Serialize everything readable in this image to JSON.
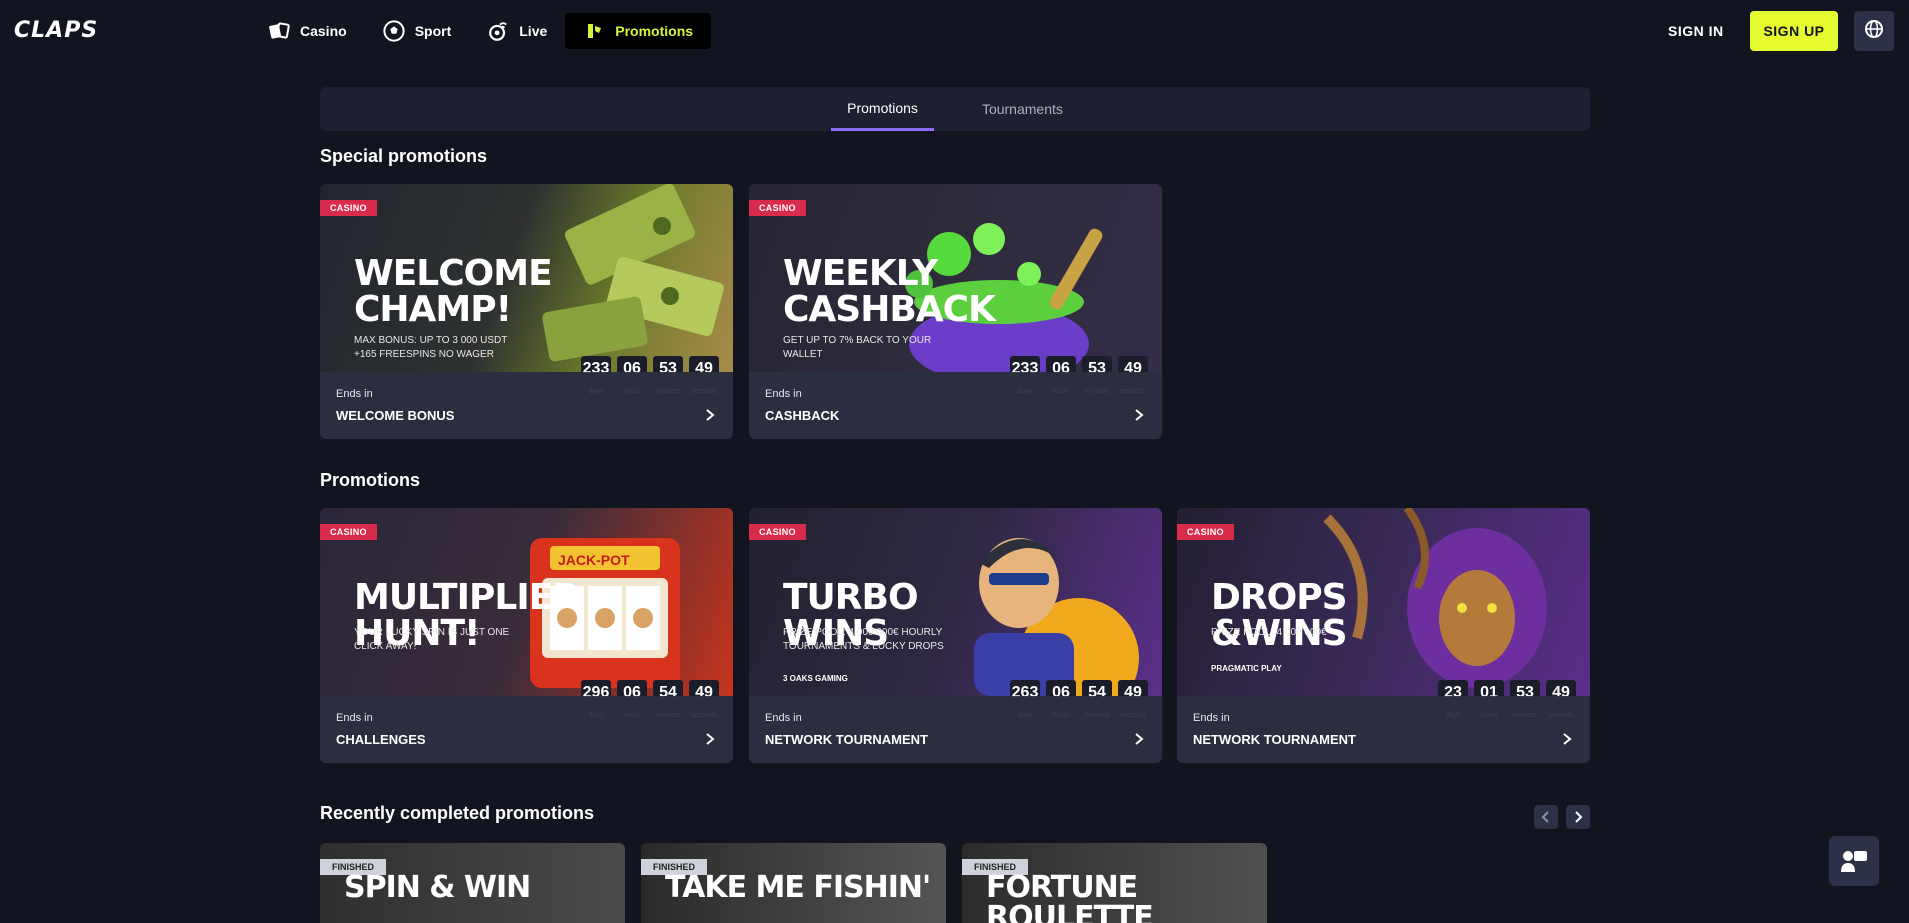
{
  "header": {
    "logo": "CLAPS",
    "nav": [
      {
        "label": "Casino",
        "icon": "cards-icon"
      },
      {
        "label": "Sport",
        "icon": "soccer-ball-icon"
      },
      {
        "label": "Live",
        "icon": "live-icon"
      },
      {
        "label": "Promotions",
        "icon": "promo-icon",
        "active": true
      }
    ],
    "sign_in": "SIGN IN",
    "sign_up": "SIGN UP"
  },
  "tabs": [
    {
      "label": "Promotions",
      "active": true
    },
    {
      "label": "Tournaments"
    }
  ],
  "sections": {
    "special": "Special promotions",
    "promotions": "Promotions",
    "completed": "Recently completed promotions"
  },
  "timer_labels": {
    "days": "days",
    "hours": "hours",
    "minutes": "minutes",
    "seconds": "seconds"
  },
  "ends_in": "Ends in",
  "special_cards": [
    {
      "badge": "CASINO",
      "headline": "WELCOME CHAMP!",
      "sub": "MAX BONUS: UP TO 3 000 USDT +165 FREESPINS NO WAGER",
      "name": "WELCOME BONUS",
      "days": "233",
      "hours": "06",
      "minutes": "53",
      "seconds": "49"
    },
    {
      "badge": "CASINO",
      "headline": "WEEKLY CASHBACK",
      "sub": "GET UP TO 7% BACK TO YOUR WALLET",
      "name": "CASHBACK",
      "days": "233",
      "hours": "06",
      "minutes": "53",
      "seconds": "49"
    }
  ],
  "promo_cards": [
    {
      "badge": "CASINO",
      "headline": "MULTIPLIER HUNT!",
      "sub": "YOUR LUCKY SPIN IS JUST ONE CLICK AWAY!",
      "art_text": "JACK-POT",
      "name": "CHALLENGES",
      "days": "296",
      "hours": "06",
      "minutes": "54",
      "seconds": "49"
    },
    {
      "badge": "CASINO",
      "headline": "TURBO WINS",
      "sub": "PRIZE POOL: 4 000 000€ HOURLY TOURNAMENTS & LUCKY DROPS",
      "art_text": "3 OAKS GAMING",
      "name": "NETWORK TOURNAMENT",
      "days": "263",
      "hours": "06",
      "minutes": "54",
      "seconds": "49"
    },
    {
      "badge": "CASINO",
      "headline": "DROPS &WINS",
      "sub": "PRIZE POOL: 4 000 000€",
      "art_text": "PRAGMATIC PLAY",
      "name": "NETWORK TOURNAMENT",
      "days": "23",
      "hours": "01",
      "minutes": "53",
      "seconds": "49"
    }
  ],
  "finished_cards": [
    {
      "badge": "FINISHED",
      "headline": "SPIN & WIN"
    },
    {
      "badge": "FINISHED",
      "headline": "TAKE ME FISHIN'"
    },
    {
      "badge": "FINISHED",
      "headline": "FORTUNE ROULETTE"
    }
  ],
  "colors": {
    "accent": "#e6fb2f",
    "badge": "#d92b4b",
    "tab_underline": "#8f6cff",
    "bg": "#121420"
  }
}
